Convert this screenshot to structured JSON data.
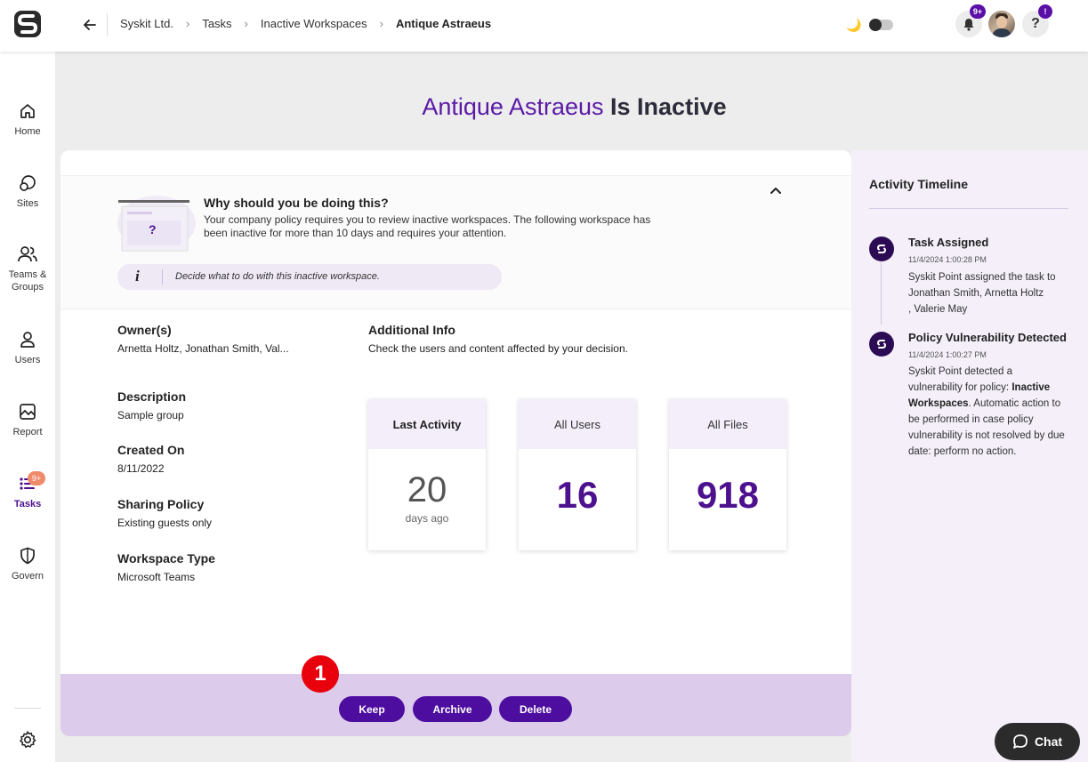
{
  "breadcrumb": {
    "items": [
      "Syskit Ltd.",
      "Tasks",
      "Inactive Workspaces"
    ],
    "current": "Antique Astraeus"
  },
  "header": {
    "notifications_badge": "9+",
    "help_badge": "!",
    "help_label": "?"
  },
  "nav": {
    "items": [
      {
        "label": "Home",
        "icon": "home-icon"
      },
      {
        "label": "Sites",
        "icon": "sites-icon"
      },
      {
        "label": "Teams & Groups",
        "icon": "teams-icon"
      },
      {
        "label": "Users",
        "icon": "user-icon"
      },
      {
        "label": "Report",
        "icon": "report-icon"
      },
      {
        "label": "Tasks",
        "icon": "tasks-icon",
        "badge": "9+",
        "active": true
      },
      {
        "label": "Govern",
        "icon": "shield-icon"
      }
    ]
  },
  "title": {
    "name": "Antique Astraeus",
    "suffix": "Is Inactive"
  },
  "why": {
    "title": "Why should you be doing this?",
    "text": "Your company policy requires you to review inactive workspaces. The following workspace has been inactive for more than 10 days and requires your attention.",
    "illustration_label": "?",
    "hint": "Decide what to do with this inactive workspace."
  },
  "details": {
    "owners_label": "Owner(s)",
    "owners_value": "Arnetta Holtz, Jonathan Smith, Val...",
    "description_label": "Description",
    "description_value": "Sample group",
    "created_label": "Created On",
    "created_value": "8/11/2022",
    "sharing_label": "Sharing Policy",
    "sharing_value": "Existing guests only",
    "type_label": "Workspace Type",
    "type_value": "Microsoft Teams"
  },
  "additional": {
    "title": "Additional Info",
    "subtitle": "Check the users and content affected by your decision."
  },
  "stats": [
    {
      "label": "Last Activity",
      "value": "20",
      "unit": "days ago"
    },
    {
      "label": "All Users",
      "value": "16"
    },
    {
      "label": "All Files",
      "value": "918"
    }
  ],
  "actions": {
    "keep": "Keep",
    "archive": "Archive",
    "delete": "Delete",
    "step_marker": "1"
  },
  "timeline": {
    "title": "Activity Timeline",
    "events": [
      {
        "title": "Task Assigned",
        "time": "11/4/2024 1:00:28 PM",
        "text_1": "Syskit Point assigned the task to",
        "text_2": "Jonathan Smith",
        "text_3": "Arnetta Holtz",
        "text_4": "Valerie May"
      },
      {
        "title": "Policy Vulnerability Detected",
        "time": "11/4/2024 1:00:27 PM",
        "text_1": "Syskit Point detected a vulnerability for policy:",
        "policy": "Inactive Workspaces",
        "text_2": ". Automatic action to be performed in case policy vulnerability is not resolved by due date: perform no action."
      }
    ]
  },
  "chat": {
    "label": "Chat"
  },
  "colors": {
    "accent": "#4d0ea0",
    "title_name": "#5a1aa6",
    "action_bar": "#dccbea",
    "timeline_bg": "#f4eff9",
    "marker": "#e8000d"
  }
}
